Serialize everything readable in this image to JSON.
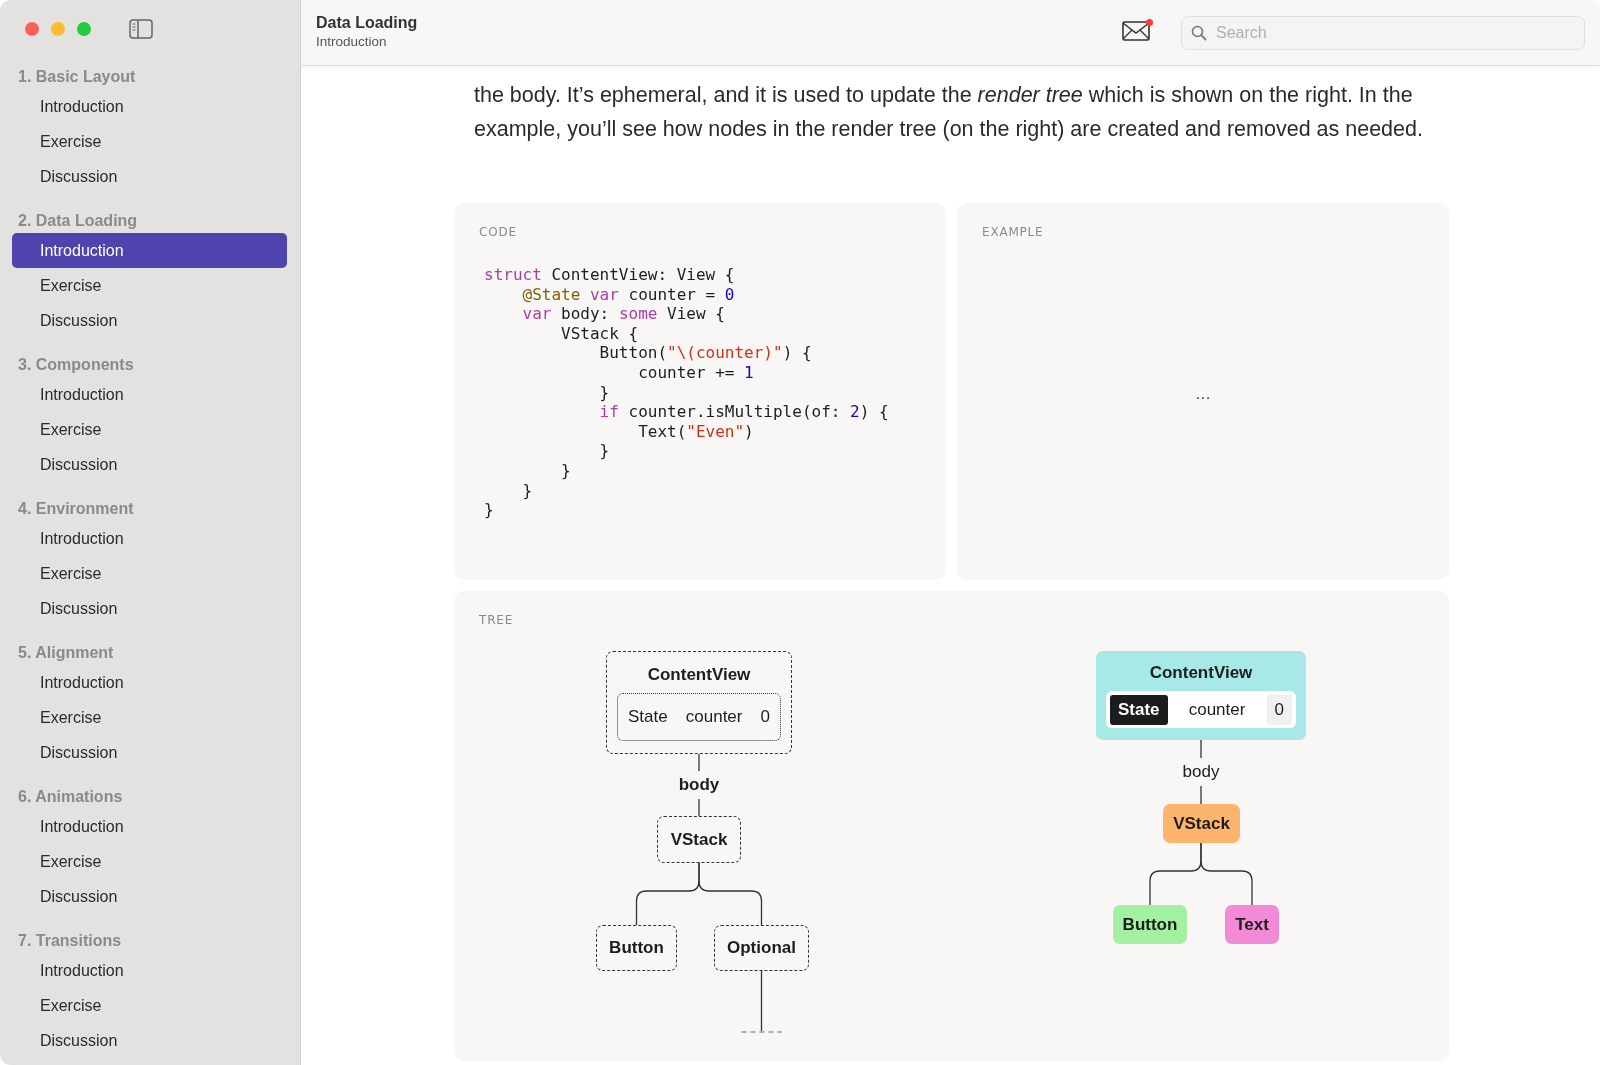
{
  "sidebar": {
    "sections": [
      {
        "title": "1. Basic Layout",
        "items": [
          {
            "label": "Introduction",
            "selected": false
          },
          {
            "label": "Exercise",
            "selected": false
          },
          {
            "label": "Discussion",
            "selected": false
          }
        ]
      },
      {
        "title": "2. Data Loading",
        "items": [
          {
            "label": "Introduction",
            "selected": true
          },
          {
            "label": "Exercise",
            "selected": false
          },
          {
            "label": "Discussion",
            "selected": false
          }
        ]
      },
      {
        "title": "3. Components",
        "items": [
          {
            "label": "Introduction",
            "selected": false
          },
          {
            "label": "Exercise",
            "selected": false
          },
          {
            "label": "Discussion",
            "selected": false
          }
        ]
      },
      {
        "title": "4. Environment",
        "items": [
          {
            "label": "Introduction",
            "selected": false
          },
          {
            "label": "Exercise",
            "selected": false
          },
          {
            "label": "Discussion",
            "selected": false
          }
        ]
      },
      {
        "title": "5. Alignment",
        "items": [
          {
            "label": "Introduction",
            "selected": false
          },
          {
            "label": "Exercise",
            "selected": false
          },
          {
            "label": "Discussion",
            "selected": false
          }
        ]
      },
      {
        "title": "6. Animations",
        "items": [
          {
            "label": "Introduction",
            "selected": false
          },
          {
            "label": "Exercise",
            "selected": false
          },
          {
            "label": "Discussion",
            "selected": false
          }
        ]
      },
      {
        "title": "7. Transitions",
        "items": [
          {
            "label": "Introduction",
            "selected": false
          },
          {
            "label": "Exercise",
            "selected": false
          },
          {
            "label": "Discussion",
            "selected": false
          }
        ]
      }
    ]
  },
  "header": {
    "title": "Data Loading",
    "subtitle": "Introduction",
    "unread": true,
    "search": {
      "placeholder": "Search"
    }
  },
  "paragraph": "the body. It’s ephemeral, and it is used to update the *render tree* which is shown on the right. In the example, you’ll see how nodes in the render tree (on the right) are created and removed as needed.",
  "code": {
    "label": "CODE",
    "lines": [
      [
        {
          "kind": "keyword",
          "text": "struct"
        },
        {
          "kind": "plain",
          "text": " ContentView: View {"
        }
      ],
      [
        {
          "kind": "attribute",
          "text": "    @State"
        },
        {
          "kind": "keyword",
          "text": " var"
        },
        {
          "kind": "plain",
          "text": " counter = "
        },
        {
          "kind": "number",
          "text": "0"
        }
      ],
      [
        {
          "kind": "keyword",
          "text": "    var"
        },
        {
          "kind": "plain",
          "text": " body: "
        },
        {
          "kind": "keyword",
          "text": "some"
        },
        {
          "kind": "plain",
          "text": " View {"
        }
      ],
      [
        {
          "kind": "plain",
          "text": "        VStack {"
        }
      ],
      [
        {
          "kind": "plain",
          "text": "            Button("
        },
        {
          "kind": "string",
          "text": "\"\\(counter)\""
        },
        {
          "kind": "plain",
          "text": ") {"
        }
      ],
      [
        {
          "kind": "plain",
          "text": "                counter += "
        },
        {
          "kind": "number",
          "text": "1"
        }
      ],
      [
        {
          "kind": "plain",
          "text": "            }"
        }
      ],
      [
        {
          "kind": "keyword",
          "text": "            if"
        },
        {
          "kind": "plain",
          "text": " counter.isMultiple(of: "
        },
        {
          "kind": "number",
          "text": "2"
        },
        {
          "kind": "plain",
          "text": ") {"
        }
      ],
      [
        {
          "kind": "plain",
          "text": "                Text("
        },
        {
          "kind": "string",
          "text": "\"Even\""
        },
        {
          "kind": "plain",
          "text": ")"
        }
      ],
      [
        {
          "kind": "plain",
          "text": "            }"
        }
      ],
      [
        {
          "kind": "plain",
          "text": "        }"
        }
      ],
      [
        {
          "kind": "plain",
          "text": "    }"
        }
      ],
      [
        {
          "kind": "plain",
          "text": "}"
        }
      ]
    ]
  },
  "example": {
    "label": "EXAMPLE",
    "content": "…"
  },
  "tree": {
    "label": "TREE",
    "view_tree": {
      "name": "ContentView",
      "state": {
        "tag": "State",
        "name": "counter",
        "value": "0"
      },
      "edge": "body",
      "children": [
        {
          "name": "VStack",
          "children": [
            {
              "name": "Button"
            },
            {
              "name": "Optional"
            }
          ]
        }
      ]
    },
    "render_tree": {
      "name": "ContentView",
      "color": "#a6e9e6",
      "state": {
        "tag": "State",
        "name": "counter",
        "value": "0"
      },
      "edge": "body",
      "children": [
        {
          "name": "VStack",
          "color": "#fdb56e",
          "children": [
            {
              "name": "Button",
              "color": "#a2f0a0"
            },
            {
              "name": "Text",
              "color": "#f28ad8"
            }
          ]
        }
      ]
    }
  }
}
